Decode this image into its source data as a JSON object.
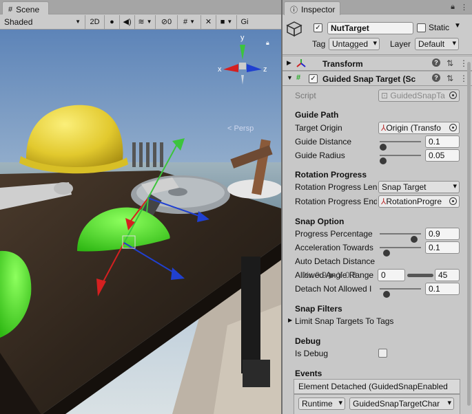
{
  "scene": {
    "tab_label": "Scene",
    "shading_mode": "Shaded",
    "mode_2d": "2D",
    "hidden_count": "0",
    "gizmos_label": "Gi",
    "axis_x": "x",
    "axis_y": "y",
    "axis_z": "z",
    "persp_label": "< Persp"
  },
  "inspector": {
    "tab_label": "Inspector",
    "object": {
      "name": "NutTarget",
      "active": true,
      "static_label": "Static",
      "tag_label": "Tag",
      "tag_value": "Untagged",
      "layer_label": "Layer",
      "layer_value": "Default"
    },
    "components": {
      "transform": {
        "title": "Transform"
      },
      "guided": {
        "title": "Guided Snap Target (Sc",
        "enabled": true
      }
    },
    "fields": {
      "script_label": "Script",
      "script_value": "GuidedSnapTa",
      "guide_path": "Guide Path",
      "target_origin_label": "Target Origin",
      "target_origin_value": "Origin (Transfo",
      "guide_distance_label": "Guide Distance",
      "guide_distance_value": "0.1",
      "guide_radius_label": "Guide Radius",
      "guide_radius_value": "0.05",
      "rotation_progress": "Rotation Progress",
      "rotation_progress_len_label": "Rotation Progress Len",
      "rotation_progress_len_value": "Snap Target",
      "rotation_progress_end_label": "Rotation Progress End",
      "rotation_progress_end_value": "RotationProgre",
      "snap_option": "Snap Option",
      "progress_percentage_label": "Progress Percentage",
      "progress_percentage_value": "0.9",
      "acceleration_label": "Acceleration Towards",
      "acceleration_value": "0.1",
      "auto_detach_label": "Auto Detach Distance",
      "allowed_angle_label": "Allowed Angle Range",
      "overlay_label": "Xx 0.9 ▶ Y 0.8",
      "allowed_angle_min": "0",
      "allowed_angle_max": "45",
      "detach_not_allowed_label": "Detach Not Allowed I",
      "detach_not_allowed_value": "0.1",
      "snap_filters": "Snap Filters",
      "limit_snap_tags_label": "Limit Snap Targets To Tags",
      "debug": "Debug",
      "is_debug_label": "Is Debug",
      "is_debug_value": false,
      "events": "Events",
      "element_detached_label": "Element Detached (GuidedSnapEnabled",
      "runtime_label": "Runtime",
      "event_function_label": "GuidedSnapTargetChar"
    }
  },
  "sliders": {
    "guide_distance": 0.0,
    "guide_radius": 0.0,
    "progress_percentage": 0.9,
    "acceleration": 0.1,
    "detach_not_allowed": 0.1
  },
  "colors": {
    "gizmo_x": "#d42020",
    "gizmo_y": "#3cc43c",
    "gizmo_z": "#2040d0",
    "snap_zone": "#55e82e",
    "helmet": "#e8d23c"
  }
}
